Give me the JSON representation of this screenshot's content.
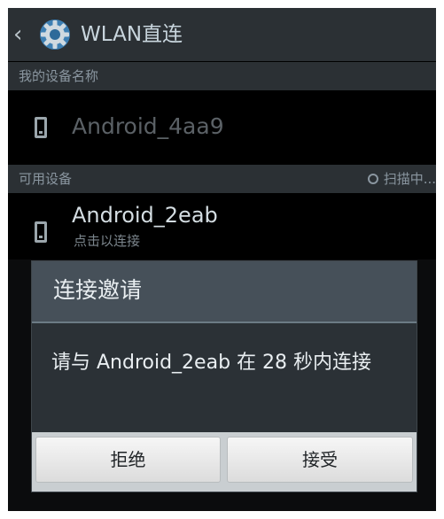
{
  "actionbar": {
    "title": "WLAN直连",
    "back_icon": "chevron-left-icon",
    "app_icon": "gear-icon"
  },
  "my_device": {
    "header": "我的设备名称",
    "name": "Android_4aa9",
    "icon": "phone-icon"
  },
  "available": {
    "header": "可用设备",
    "scan_status": "扫描中...",
    "devices": [
      {
        "name": "Android_2eab",
        "subtitle": "点击以连接",
        "icon": "phone-icon"
      }
    ]
  },
  "dialog": {
    "title": "连接邀请",
    "message": "请与 Android_2eab 在 28 秒内连接",
    "reject_label": "拒绝",
    "accept_label": "接受"
  },
  "colors": {
    "actionbar_bg": "#2b3034",
    "dialog_title_bg": "#465059",
    "dialog_body_bg": "#2b3136",
    "button_bar_bg": "#c9ced1"
  }
}
